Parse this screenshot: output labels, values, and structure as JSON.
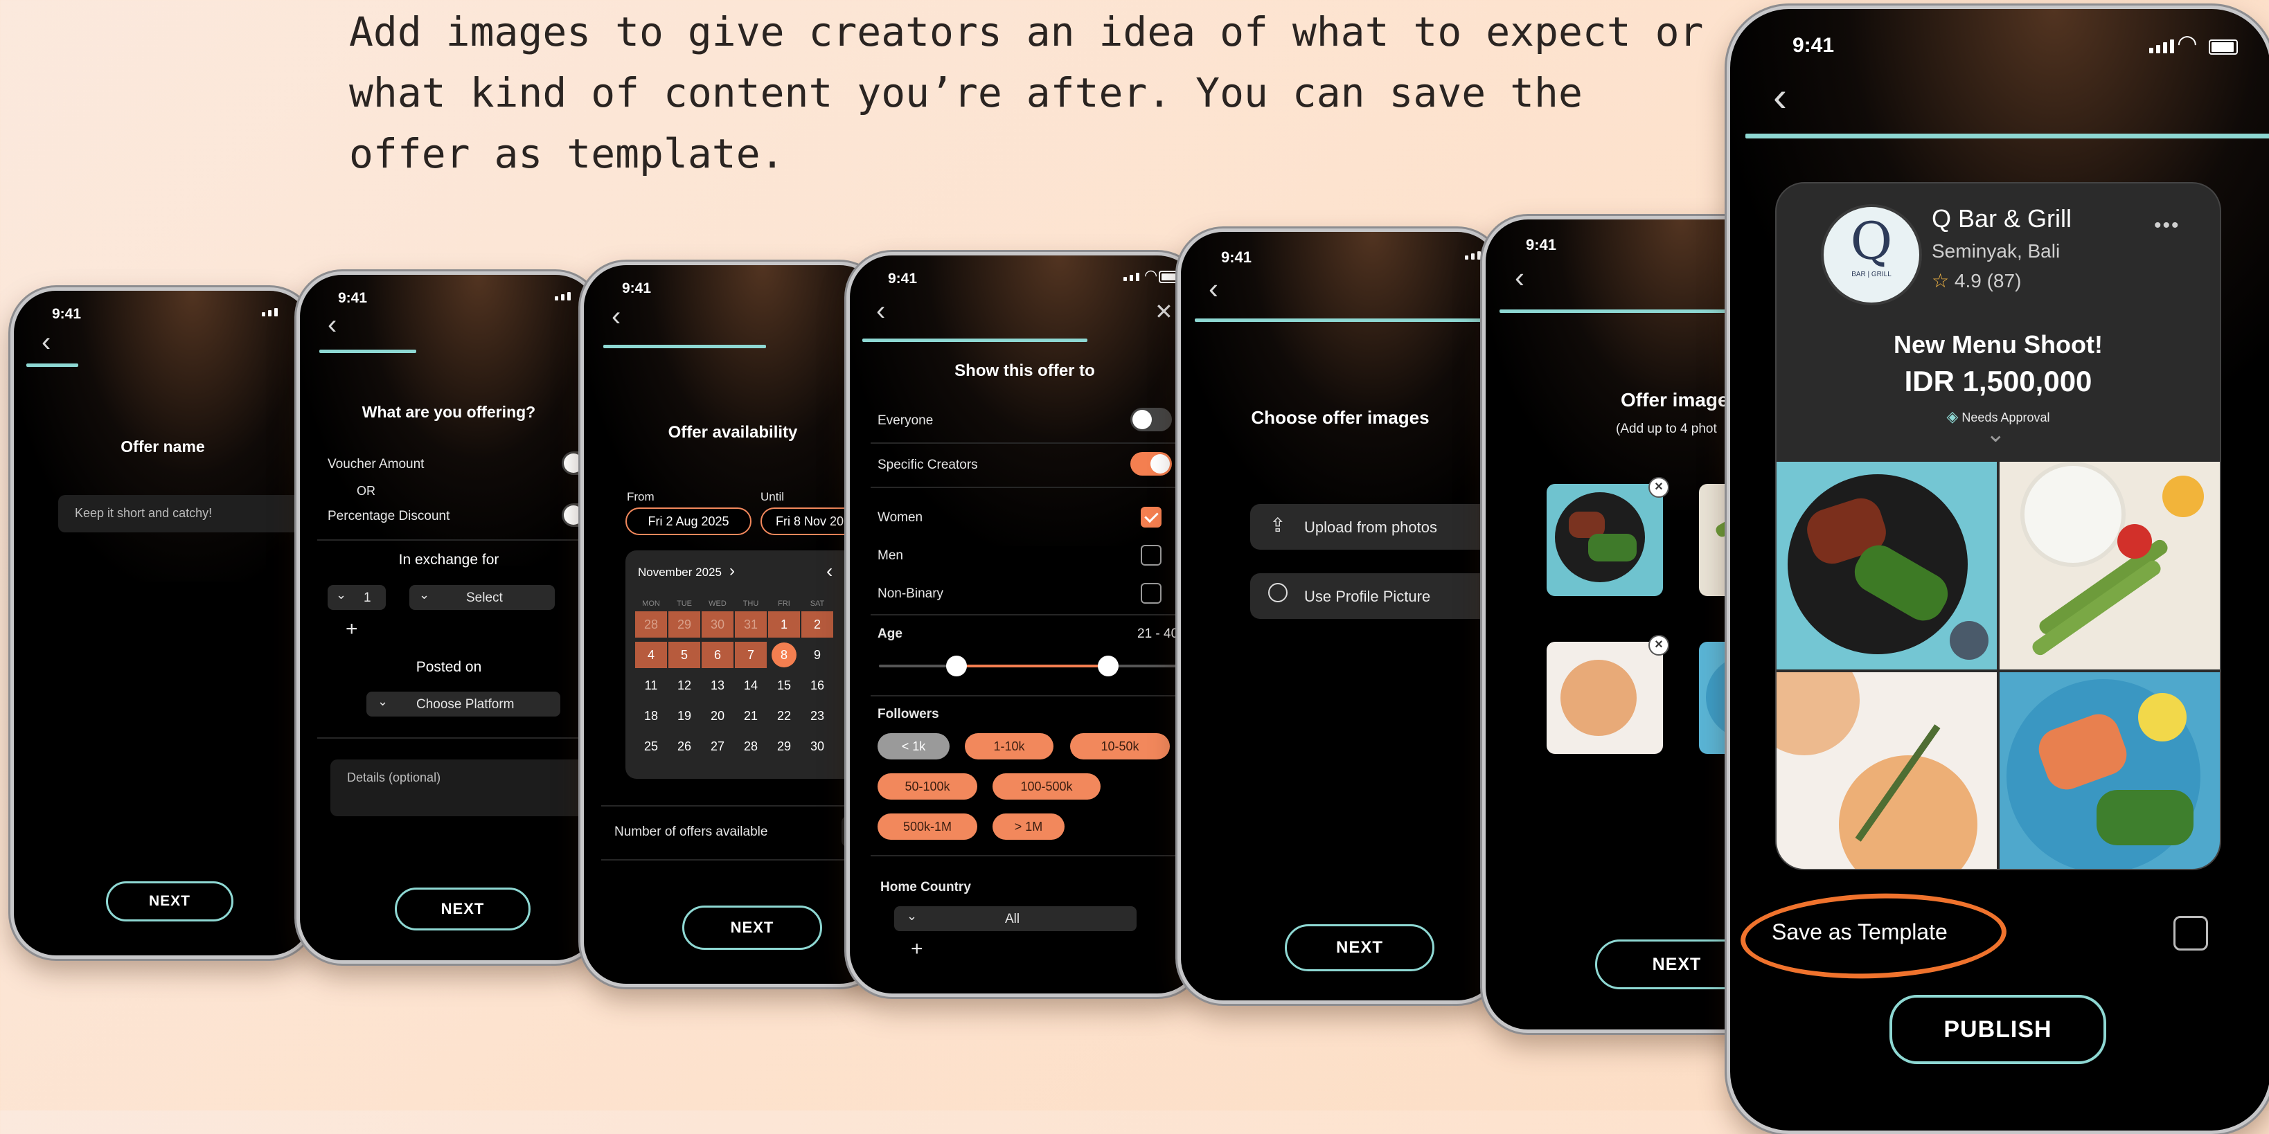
{
  "caption": "Add images to give creators an idea of what to expect or what kind of content you’re after. You can save the offer as template.",
  "status_time": "9:41",
  "colors": {
    "accent_teal": "#8ed8d3",
    "accent_orange": "#f47f50",
    "background": "#000000"
  },
  "next_label": "NEXT",
  "screen1": {
    "title": "Offer name",
    "placeholder": "Keep it short and catchy!"
  },
  "screen2": {
    "title": "What are you offering?",
    "voucher": "Voucher Amount",
    "or": "OR",
    "percentage": "Percentage Discount",
    "exchange": "In exchange for",
    "qty": "1",
    "select": "Select",
    "plus": "+",
    "posted_on": "Posted on",
    "platform": "Choose Platform",
    "details": "Details (optional)"
  },
  "screen3": {
    "title": "Offer availability",
    "from_label": "From",
    "until_label": "Until",
    "from_value": "Fri 2 Aug 2025",
    "until_value": "Fri 8 Nov 20",
    "month": "November 2025",
    "weekdays": [
      "MON",
      "TUE",
      "WED",
      "THU",
      "FRI",
      "SAT"
    ],
    "weeks": [
      [
        "28",
        "29",
        "30",
        "31",
        "1",
        "2"
      ],
      [
        "4",
        "5",
        "6",
        "7",
        "8",
        "9"
      ],
      [
        "11",
        "12",
        "13",
        "14",
        "15",
        "16"
      ],
      [
        "18",
        "19",
        "20",
        "21",
        "22",
        "23"
      ],
      [
        "25",
        "26",
        "27",
        "28",
        "29",
        "30"
      ]
    ],
    "num_offers": "Number of offers available"
  },
  "screen4": {
    "title": "Show this offer to",
    "everyone": "Everyone",
    "specific": "Specific Creators",
    "women": "Women",
    "men": "Men",
    "nonbinary": "Non-Binary",
    "age": "Age",
    "age_range": "21 - 40",
    "age_min_fraction": 0.26,
    "age_max_fraction": 0.77,
    "followers": "Followers",
    "chips": [
      "< 1k",
      "1-10k",
      "10-50k",
      "50-100k",
      "100-500k",
      "500k-1M",
      "> 1M"
    ],
    "home_country": "Home Country",
    "country": "All",
    "plus": "+"
  },
  "screen5": {
    "title": "Choose offer images",
    "upload": "Upload from photos",
    "profile": "Use Profile Picture"
  },
  "screen6": {
    "title": "Offer image",
    "subtitle": "(Add up to 4 phot"
  },
  "screen7": {
    "venue": "Q Bar & Grill",
    "location": "Seminyak, Bali",
    "rating": "4.9",
    "reviews": "(87)",
    "offer_title": "New Menu Shoot!",
    "price": "IDR 1,500,000",
    "approval": "Needs Approval",
    "more": "•••",
    "logo_letter": "Q",
    "logo_sub": "BAR | GRILL",
    "save_template": "Save as Template",
    "publish": "PUBLISH"
  }
}
